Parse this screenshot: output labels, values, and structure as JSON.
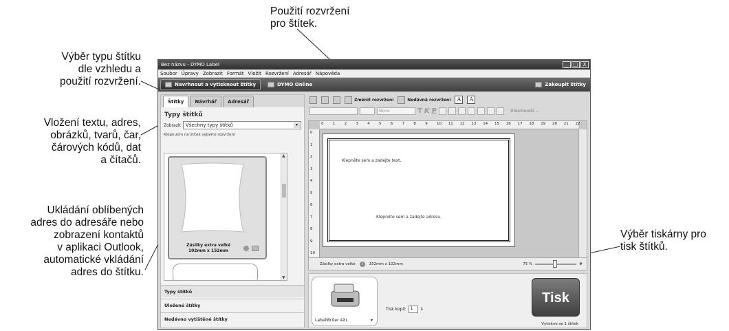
{
  "callouts": {
    "top": [
      "Použití rozvržení",
      "pro štítek."
    ],
    "type": [
      "Výběr typu štítku",
      "dle vzhledu a",
      "použití rozvržení."
    ],
    "insert": [
      "Vložení textu, adres,",
      "obrázků, tvarů, čar,",
      "čárových kódů, dat",
      "a čítačů."
    ],
    "save": [
      "Ukládání oblíbených",
      "adres do adresáře nebo",
      "zobrazení kontaktů",
      "v aplikaci Outlook,",
      "automatické vkládání",
      "adres do štítku."
    ],
    "printer": [
      "Výběr tiskárny pro",
      "tisk štítků."
    ]
  },
  "window": {
    "title": "Bez názvu - DYMO Label",
    "controls": [
      "_",
      "□",
      "X"
    ],
    "menu": [
      "Soubor",
      "Úpravy",
      "Zobrazit",
      "Formát",
      "Vložit",
      "Rozvržení",
      "Adresář",
      "Nápověda"
    ],
    "mode_design": "Navrhnout a vytisknout štítky",
    "mode_online": "DYMO Online",
    "buy": "Zakoupit štítky"
  },
  "left": {
    "tabs": [
      "Štítky",
      "Návrhář",
      "Adresář"
    ],
    "title": "Typy štítků",
    "show_label": "Zobrazit",
    "show_value": "Všechny typy štítků",
    "hint": "Klepnutím na štítek vyberte rozvržení",
    "card_name": [
      "Zásilky extra velké",
      "102mm x 152mm"
    ],
    "accordion": [
      "Typy štítků",
      "Uložené štítky",
      "Nedávno vytištěné štítky"
    ]
  },
  "toolbar": {
    "change_layout": "Změnit rozvržení",
    "recent_layout": "Nedávná rozvržení",
    "font_a1": "A",
    "font_a2": "A",
    "font_combo": "None",
    "styles": [
      "T",
      "K",
      "P"
    ],
    "properties": "Vlastnosti..."
  },
  "editor": {
    "ruler": [
      "0",
      "1",
      "2",
      "3",
      "4",
      "5",
      "6",
      "7",
      "8",
      "9",
      "10",
      "11",
      "12",
      "13",
      "14",
      "15",
      "16",
      "17",
      "18",
      "19",
      "20",
      "21",
      "22"
    ],
    "vruler": [
      "0",
      "1",
      "2",
      "3",
      "4",
      "5",
      "6",
      "7",
      "8",
      "9",
      "10"
    ],
    "text_prompt": "Klepněte sem a zadejte text.",
    "address_prompt": "Klepněte sem a zadejte adresu.",
    "status_label": "Zásilky extra velké",
    "status_size": "152mm x 102mm",
    "zoom": "75 %"
  },
  "print": {
    "printer": "LabelWriter 4XL",
    "copies_label": "Tisk kopií:",
    "copies_value": "1",
    "button": "Tisk",
    "note": "Vytiskne se 1 štítek"
  }
}
